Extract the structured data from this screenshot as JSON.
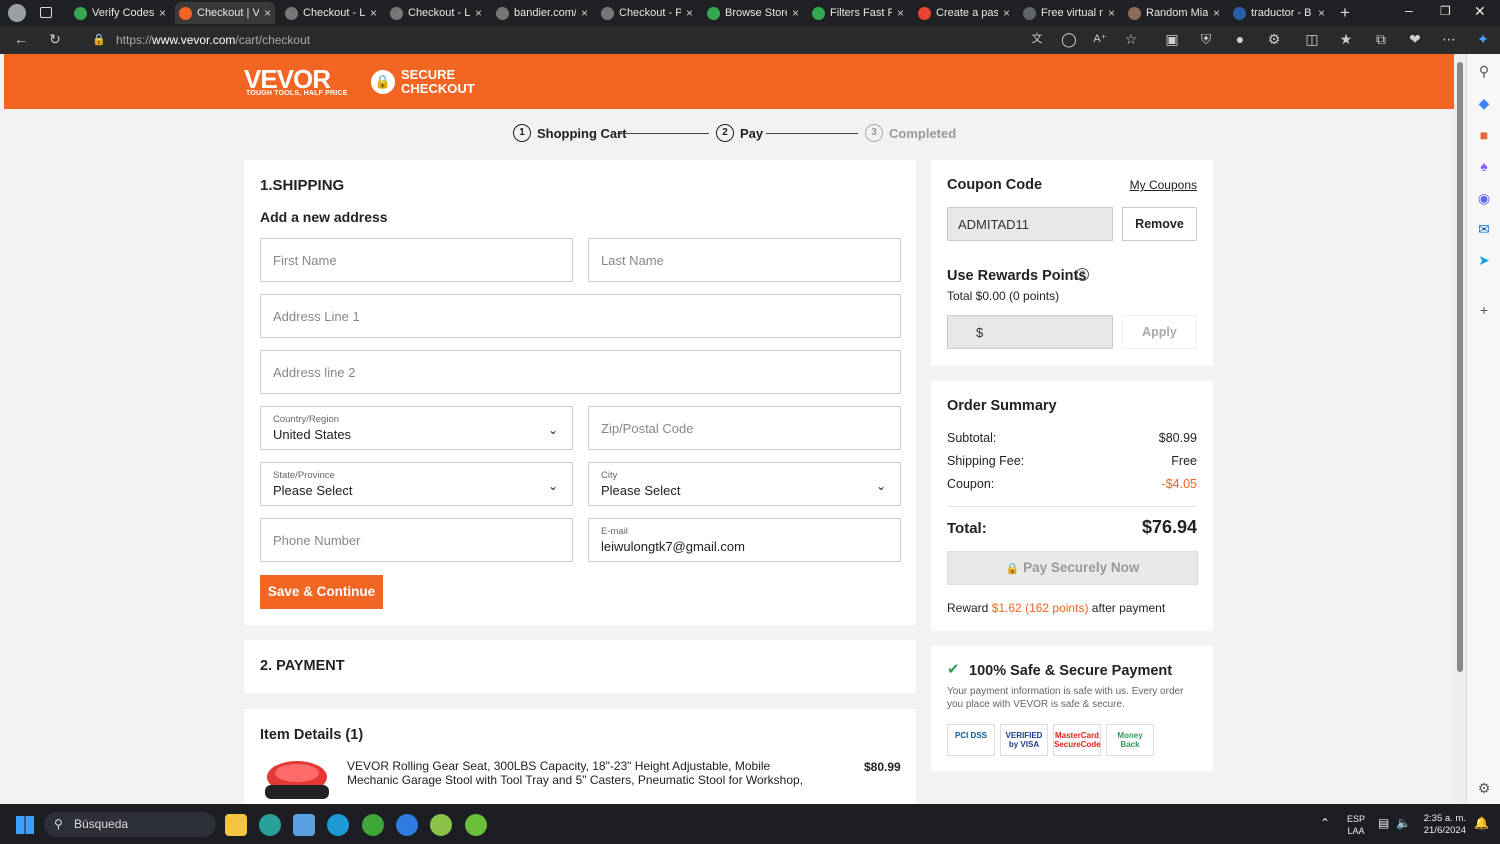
{
  "browser": {
    "tabs": [
      {
        "label": "Verify Codes",
        "color": "#34a853"
      },
      {
        "label": "Checkout | V",
        "color": "#f26522",
        "active": true
      },
      {
        "label": "Checkout - L",
        "color": "#777"
      },
      {
        "label": "Checkout - L",
        "color": "#777"
      },
      {
        "label": "bandier.com/",
        "color": "#777"
      },
      {
        "label": "Checkout - P",
        "color": "#777"
      },
      {
        "label": "Browse Store",
        "color": "#34a853"
      },
      {
        "label": "Filters Fast P",
        "color": "#34a853"
      },
      {
        "label": "Create a pas",
        "color": "#ea4335"
      },
      {
        "label": "Free virtual n",
        "color": "#5f6368"
      },
      {
        "label": "Random Mia",
        "color": "#8a6d5a"
      },
      {
        "label": "traductor - B",
        "color": "#2a5caa"
      }
    ],
    "url_prefix": "https://",
    "url_host": "www.vevor.com",
    "url_path": "/cart/checkout"
  },
  "header": {
    "logo": "VEVOR",
    "tagline": "TOUGH TOOLS, HALF PRICE",
    "secure_line1": "SECURE",
    "secure_line2": "CHECKOUT",
    "accent": "#f26522"
  },
  "steps": [
    {
      "num": "1",
      "label": "Shopping Cart"
    },
    {
      "num": "2",
      "label": "Pay"
    },
    {
      "num": "3",
      "label": "Completed"
    }
  ],
  "shipping": {
    "title": "1.SHIPPING",
    "subtitle": "Add a new address",
    "first_name": "First Name",
    "last_name": "Last Name",
    "address1": "Address Line 1",
    "address2": "Address line 2",
    "country_label": "Country/Region",
    "country_value": "United States",
    "zip": "Zip/Postal Code",
    "state_label": "State/Province",
    "state_value": "Please Select",
    "city_label": "City",
    "city_value": "Please Select",
    "phone": "Phone Number",
    "email_label": "E-mail",
    "email_value": "leiwulongtk7@gmail.com",
    "save_button": "Save & Continue"
  },
  "payment": {
    "title": "2. PAYMENT"
  },
  "items": {
    "title": "Item Details (1)",
    "list": [
      {
        "desc": "VEVOR Rolling Gear Seat, 300LBS Capacity, 18\"-23\" Height Adjustable, Mobile Mechanic Garage Stool with Tool Tray and 5\" Casters, Pneumatic Stool for Workshop, Garage, Auto Repair ...",
        "price": "$80.99"
      }
    ]
  },
  "coupon": {
    "title": "Coupon Code",
    "my_coupons": "My Coupons",
    "code": "ADMITAD11",
    "remove": "Remove"
  },
  "rewards": {
    "title": "Use Rewards Points",
    "total": "Total $0.00 (0 points)",
    "currency": "$",
    "apply": "Apply"
  },
  "summary": {
    "title": "Order Summary",
    "rows": [
      {
        "label": "Subtotal:",
        "value": "$80.99"
      },
      {
        "label": "Shipping Fee:",
        "value": "Free"
      },
      {
        "label": "Coupon:",
        "value": "-$4.05"
      }
    ],
    "total_label": "Total:",
    "total_value": "$76.94",
    "pay_button": "Pay Securely Now",
    "reward_prefix": "Reward",
    "reward_amount": "$1.62 (162 points)",
    "reward_suffix": "after payment"
  },
  "secure": {
    "title": "100% Safe & Secure Payment",
    "text": "Your payment information is safe with us. Every order you place with VEVOR is safe & secure.",
    "badges": [
      "PCI DSS",
      "VERIFIED by VISA",
      "MasterCard SecureCode",
      "Money Back"
    ]
  },
  "taskbar": {
    "search": "Búsqueda",
    "lang1": "ESP",
    "lang2": "LAA",
    "time": "2:35 a. m.",
    "date": "21/6/2024"
  }
}
